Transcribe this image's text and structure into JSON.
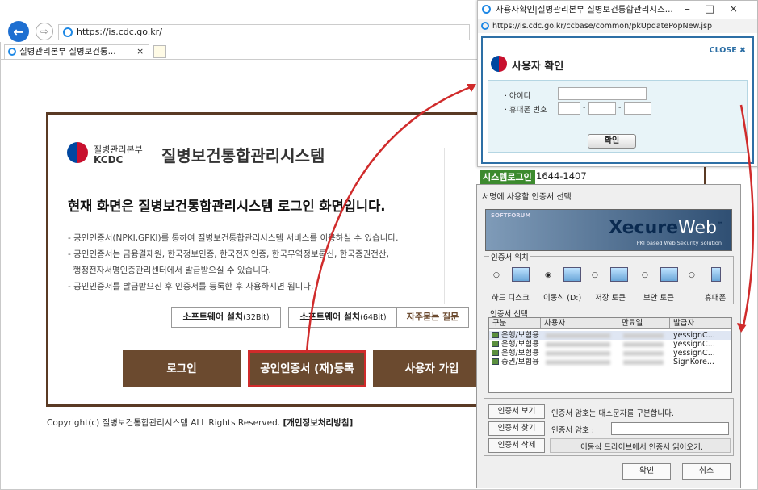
{
  "browser": {
    "url": "https://is.cdc.go.kr/",
    "tab_title": "질병관리본부 질병보건통...",
    "tab_close": "×"
  },
  "login": {
    "logo_ko": "질병관리본부",
    "logo_en": "KCDC",
    "system_title": "질병보건통합관리시스템",
    "heading": "현재 화면은 질병보건통합관리시스템 로그인 화면입니다.",
    "bullets": [
      "- 공인인증서(NPKI,GPKI)를 통하여 질병보건통합관리시스템 서비스를 이용하실 수 있습니다.",
      "- 공인인증서는 금융결제원, 한국정보인증, 한국전자인증, 한국무역정보통신, 한국증권전산,",
      "  행정전자서명인증관리센터에서 발급받으실 수 있습니다.",
      "- 공인인증서를 발급받으신 후 인증서를 등록한 후 사용하시면 됩니다."
    ],
    "sw32_label": "소프트웨어 설치",
    "sw32_bit": "(32Bit)",
    "sw64_label": "소프트웨어 설치",
    "sw64_bit": "(64Bit)",
    "faq_label": "자주묻는 질문",
    "login_button": "로그인",
    "register_button": "공인인증서 (재)등록",
    "join_button": "사용자 가입",
    "copyright": "Copyright(c) 질병보건통합관리시스템 ALL Rights Reserved.",
    "privacy_link": "[개인정보처리방침]",
    "accent_color": "#6b4a2f",
    "highlight_color": "#d02b2b"
  },
  "popup_user": {
    "window_title": "사용자확인|질병관리본부 질병보건통합관리시스...",
    "window_controls": "–□×",
    "url": "https://is.cdc.go.kr/ccbase/common/pkUpdatePopNew.jsp",
    "close_label": "CLOSE",
    "title": "사용자 확인",
    "id_label": "· 아이디",
    "phone_label": "· 휴대폰 번호",
    "dash": "-",
    "confirm_button": "확인"
  },
  "system_login": {
    "label": "시스템로그인",
    "phone": "1644-1407"
  },
  "cert_dialog": {
    "title": "서명에 사용할 인증서 선택",
    "brand_small": "SOFTFORUM",
    "brand_bold": "Xecure",
    "brand_light": "Web",
    "brand_tm": "™",
    "brand_sub": "PKI based Web Security Solution",
    "location_group": "인증서 위치",
    "locations": [
      "하드 디스크",
      "이동식 (D:)",
      "저장 토큰",
      "보안 토큰",
      "휴대폰"
    ],
    "list_group": "인증서 선택",
    "columns": [
      "구분",
      "사용자",
      "만료일",
      "발급자"
    ],
    "rows": [
      {
        "type": "은행/보험용",
        "issuer": "yessignC..."
      },
      {
        "type": "은행/보험용",
        "issuer": "yessignC..."
      },
      {
        "type": "은행/보험용",
        "issuer": "yessignC..."
      },
      {
        "type": "증권/보험용",
        "issuer": "SignKore..."
      }
    ],
    "view_button": "인증서 보기",
    "case_note": "인증서 암호는 대소문자를 구분합니다.",
    "find_button": "인증서 찾기",
    "password_label": "인증서 암호 :",
    "delete_button": "인증서 삭제",
    "read_note": "이동식 드라이브에서 인증서 읽어오기.",
    "ok_button": "확인",
    "cancel_button": "취소"
  }
}
